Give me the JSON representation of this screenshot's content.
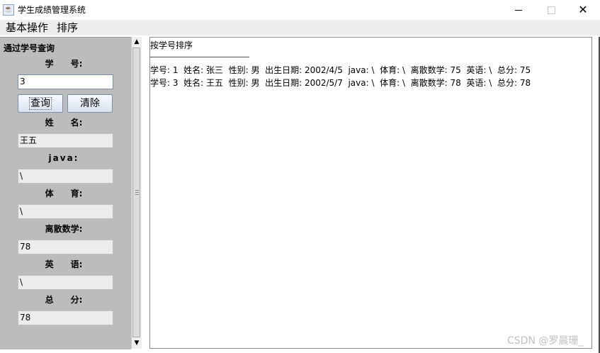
{
  "window": {
    "title": "学生成绩管理系统",
    "icon": "java-cup-icon",
    "minimize": "—",
    "maximize": "☐",
    "close": "✕"
  },
  "menu": {
    "basic_ops": "基本操作",
    "sort": "排序"
  },
  "left_panel": {
    "heading": "通过学号查询",
    "student_id_label": "学　　号:",
    "student_id_value": "3",
    "query_button": "查询",
    "clear_button": "清除",
    "name_label": "姓　　名:",
    "name_value": "王五",
    "java_label": "java:",
    "java_value": "\\",
    "pe_label": "体　　育:",
    "pe_value": "\\",
    "discrete_label": "离散数学:",
    "discrete_value": "78",
    "english_label": "英　　语:",
    "english_value": "\\",
    "total_label": "总　　分:",
    "total_value": "78"
  },
  "output": {
    "heading": "按学号排序",
    "rows": [
      "学号: 1  姓名: 张三  性别: 男  出生日期: 2002/4/5  java: \\  体育: \\  离散数学: 75  英语: \\  总分: 75",
      "学号: 3  姓名: 王五  性别: 男  出生日期: 2002/5/7  java: \\  体育: \\  离散数学: 78  英语: \\  总分: 78"
    ]
  },
  "watermark": "CSDN @罗晨珊_"
}
